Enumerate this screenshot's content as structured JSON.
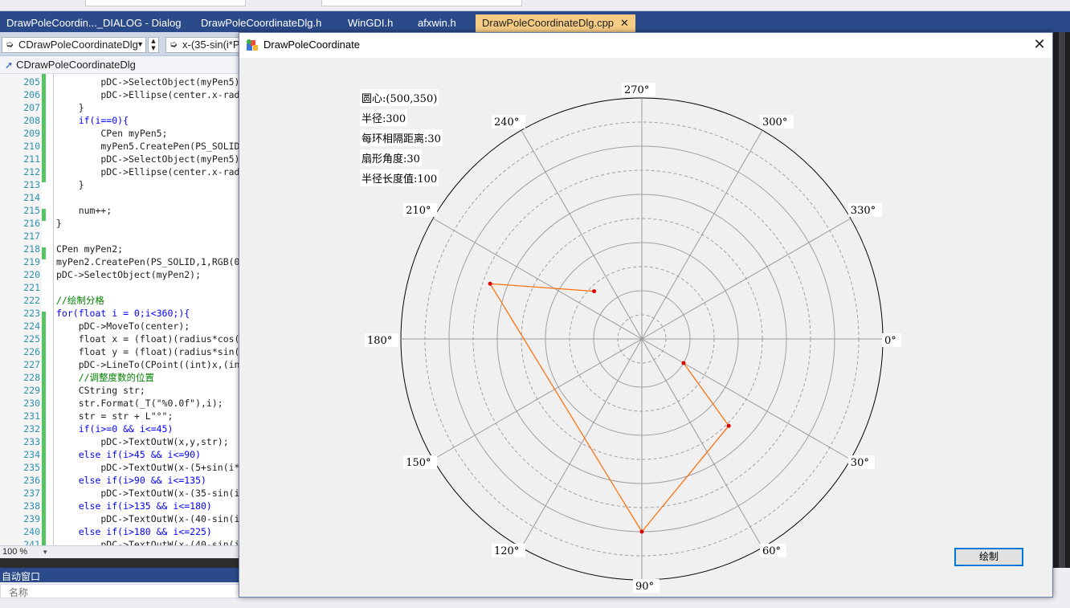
{
  "ide": {
    "tabs": [
      {
        "label": "DrawPoleCoordin..._DIALOG - Dialog",
        "active": false
      },
      {
        "label": "DrawPoleCoordinateDlg.h",
        "active": false
      },
      {
        "label": "WinGDI.h",
        "active": false
      },
      {
        "label": "afxwin.h",
        "active": false
      },
      {
        "label": "DrawPoleCoordinateDlg.cpp",
        "active": true,
        "close": "✕"
      }
    ],
    "nav_combo_class": "CDrawPoleCoordinateDlg",
    "nav_combo_member": "x-(35-sin(i*P",
    "breadcrumb": "CDrawPoleCoordinateDlg",
    "zoom": "100 %",
    "code_lines": [
      {
        "n": "205",
        "code": "        pDC->SelectObject(myPen5);"
      },
      {
        "n": "206",
        "code": "        pDC->Ellipse(center.x-radius,"
      },
      {
        "n": "207",
        "code": "    }"
      },
      {
        "n": "208",
        "code": "    if(i==0){"
      },
      {
        "n": "209",
        "code": "        CPen myPen5;"
      },
      {
        "n": "210",
        "code": "        myPen5.CreatePen(PS_SOLID,1,"
      },
      {
        "n": "211",
        "code": "        pDC->SelectObject(myPen5);"
      },
      {
        "n": "212",
        "code": "        pDC->Ellipse(center.x-radius,"
      },
      {
        "n": "213",
        "code": "    }"
      },
      {
        "n": "214",
        "code": ""
      },
      {
        "n": "215",
        "code": "    num++;"
      },
      {
        "n": "216",
        "code": "}"
      },
      {
        "n": "217",
        "code": ""
      },
      {
        "n": "218",
        "code": "CPen myPen2;"
      },
      {
        "n": "219",
        "code": "myPen2.CreatePen(PS_SOLID,1,RGB(0,0,0));"
      },
      {
        "n": "220",
        "code": "pDC->SelectObject(myPen2);"
      },
      {
        "n": "221",
        "code": ""
      },
      {
        "n": "222",
        "code": "//绘制分格"
      },
      {
        "n": "223",
        "code": "for(float i = 0;i<360;){"
      },
      {
        "n": "224",
        "code": "    pDC->MoveTo(center);"
      },
      {
        "n": "225",
        "code": "    float x = (float)(radius*cos("
      },
      {
        "n": "226",
        "code": "    float y = (float)(radius*sin("
      },
      {
        "n": "227",
        "code": "    pDC->LineTo(CPoint((int)x,(int)y));"
      },
      {
        "n": "228",
        "code": "    //调整度数的位置"
      },
      {
        "n": "229",
        "code": "    CString str;"
      },
      {
        "n": "230",
        "code": "    str.Format(_T(\"%0.0f\"),i);"
      },
      {
        "n": "231",
        "code": "    str = str + L\"°\";"
      },
      {
        "n": "232",
        "code": "    if(i>=0 && i<=45)"
      },
      {
        "n": "233",
        "code": "        pDC->TextOutW(x,y,str);"
      },
      {
        "n": "234",
        "code": "    else if(i>45 && i<=90)"
      },
      {
        "n": "235",
        "code": "        pDC->TextOutW(x-(5+sin(i*PI"
      },
      {
        "n": "236",
        "code": "    else if(i>90 && i<=135)"
      },
      {
        "n": "237",
        "code": "        pDC->TextOutW(x-(35-sin(i*PI"
      },
      {
        "n": "238",
        "code": "    else if(i>135 && i<=180)"
      },
      {
        "n": "239",
        "code": "        pDC->TextOutW(x-(40-sin(i*PI"
      },
      {
        "n": "240",
        "code": "    else if(i>180 && i<=225)"
      },
      {
        "n": "241",
        "code": "        pDC->TextOutW(x-(40-sin(i*PI"
      }
    ],
    "auto_window": {
      "title": "自动窗口",
      "col_name": "名称"
    }
  },
  "dialog": {
    "title": "DrawPoleCoordinate",
    "close": "✕",
    "info": {
      "center": "圆心:(500,350)",
      "radius": "半径:300",
      "ring_spacing": "每环相隔距离:30",
      "sector_angle": "扇形角度:30",
      "radius_length": "半径长度值:100"
    },
    "draw_button": "绘制",
    "angle_labels": [
      "0°",
      "30°",
      "60°",
      "90°",
      "120°",
      "150°",
      "180°",
      "210°",
      "240°",
      "270°",
      "300°",
      "330°"
    ]
  },
  "chart_data": {
    "type": "scatter",
    "subtype": "polar",
    "angle_direction": "clockwise from right, y axis downward",
    "radius_max": 100,
    "ring_step": 10,
    "sector_step_deg": 30,
    "grid": true,
    "polyline_color": "#ff6a00",
    "point_color": "#e00000",
    "points": [
      {
        "angle": 225,
        "r": 28
      },
      {
        "angle": 200,
        "r": 67
      },
      {
        "angle": 90,
        "r": 80
      },
      {
        "angle": 45,
        "r": 51
      },
      {
        "angle": 30,
        "r": 20
      }
    ]
  }
}
